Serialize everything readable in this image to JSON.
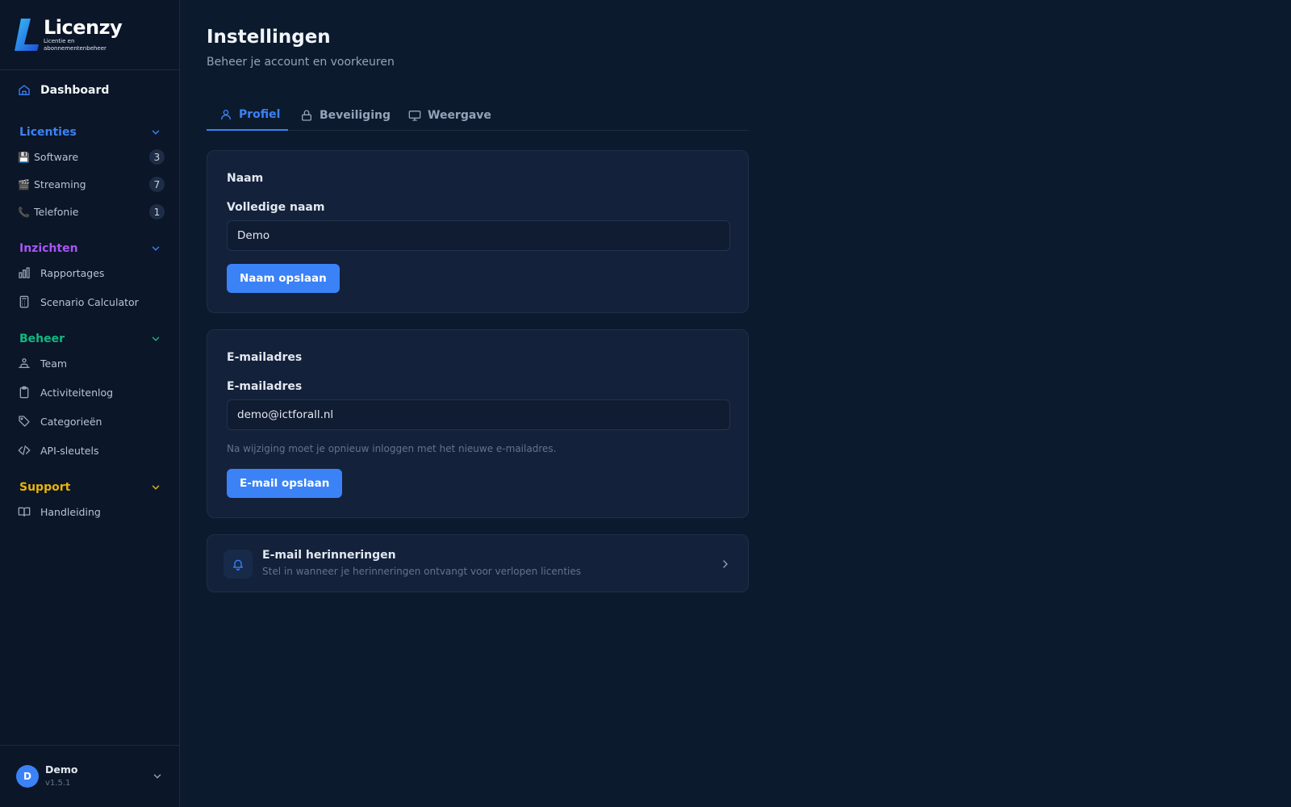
{
  "brand": {
    "name": "Licenzy",
    "tagline": "Licentie en abonnementenbeheer"
  },
  "sidebar": {
    "dashboard": "Dashboard",
    "sections": {
      "licenties": {
        "title": "Licenties",
        "color": "#3b82f6",
        "items": [
          {
            "emoji": "💾",
            "label": "Software",
            "count": "3"
          },
          {
            "emoji": "🎬",
            "label": "Streaming",
            "count": "7"
          },
          {
            "emoji": "📞",
            "label": "Telefonie",
            "count": "1"
          }
        ]
      },
      "inzichten": {
        "title": "Inzichten",
        "color": "#a855f7",
        "items": [
          {
            "label": "Rapportages",
            "icon": "bar-chart-icon"
          },
          {
            "label": "Scenario Calculator",
            "icon": "calculator-icon"
          }
        ]
      },
      "beheer": {
        "title": "Beheer",
        "color": "#10b981",
        "items": [
          {
            "label": "Team",
            "icon": "team-icon"
          },
          {
            "label": "Activiteitenlog",
            "icon": "clipboard-icon"
          },
          {
            "label": "Categorieën",
            "icon": "tag-icon"
          },
          {
            "label": "API-sleutels",
            "icon": "code-icon"
          }
        ]
      },
      "support": {
        "title": "Support",
        "color": "#eab308",
        "items": [
          {
            "label": "Handleiding",
            "icon": "book-icon"
          }
        ]
      }
    },
    "user": {
      "initial": "D",
      "name": "Demo",
      "version": "v1.5.1"
    }
  },
  "page": {
    "title": "Instellingen",
    "subtitle": "Beheer je account en voorkeuren",
    "tabs": [
      {
        "label": "Profiel",
        "icon": "user-icon",
        "active": true
      },
      {
        "label": "Beveiliging",
        "icon": "lock-icon",
        "active": false
      },
      {
        "label": "Weergave",
        "icon": "monitor-icon",
        "active": false
      }
    ]
  },
  "name_card": {
    "title": "Naam",
    "field_label": "Volledige naam",
    "value": "Demo",
    "button": "Naam opslaan"
  },
  "email_card": {
    "title": "E-mailadres",
    "field_label": "E-mailadres",
    "value": "demo@ictforall.nl",
    "hint": "Na wijziging moet je opnieuw inloggen met het nieuwe e-mailadres.",
    "button": "E-mail opslaan"
  },
  "reminder_card": {
    "title": "E-mail herinneringen",
    "subtitle": "Stel in wanneer je herinneringen ontvangt voor verlopen licenties",
    "icon": "bell-icon"
  },
  "colors": {
    "accent": "#3b82f6",
    "background": "#0c1a2e",
    "sidebar": "#0b1628",
    "card": "#13213a"
  }
}
